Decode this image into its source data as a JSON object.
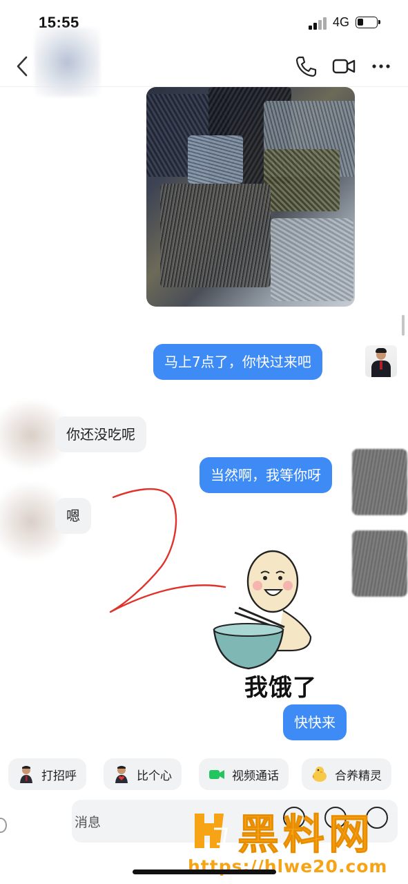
{
  "status_bar": {
    "time": "15:55",
    "network": "4G",
    "battery_level": 0.35
  },
  "nav": {
    "back_icon": "chevron-left-icon",
    "call_icon": "phone-icon",
    "video_icon": "video-camera-icon",
    "more_icon": "more-dots-icon"
  },
  "messages": [
    {
      "type": "image",
      "direction": "out",
      "content": "redacted photo"
    },
    {
      "type": "text",
      "direction": "out",
      "text": "马上7点了，你快过来吧"
    },
    {
      "type": "text",
      "direction": "in",
      "text": "你还没吃呢"
    },
    {
      "type": "text",
      "direction": "out",
      "text": "当然啊，我等你呀"
    },
    {
      "type": "text",
      "direction": "in",
      "text": "嗯"
    },
    {
      "type": "sticker",
      "direction": "out",
      "caption": "我饿了"
    },
    {
      "type": "text",
      "direction": "out",
      "text": "快快来"
    }
  ],
  "quick_actions": [
    {
      "label": "打招呼",
      "icon": "wave-person-icon"
    },
    {
      "label": "比个心",
      "icon": "heart-person-icon"
    },
    {
      "label": "视频通话",
      "icon": "video-call-icon"
    },
    {
      "label": "合养精灵",
      "icon": "chick-icon"
    }
  ],
  "input": {
    "placeholder": "消息",
    "buttons": [
      "voice-icon",
      "emoji-icon",
      "plus-icon"
    ]
  },
  "watermark": {
    "title": "黑料网",
    "url": "https://hlwe20.com"
  },
  "colors": {
    "bubble_out": "#3f8bf5",
    "bubble_in": "#f1f2f4",
    "watermark": "#f6a316"
  }
}
